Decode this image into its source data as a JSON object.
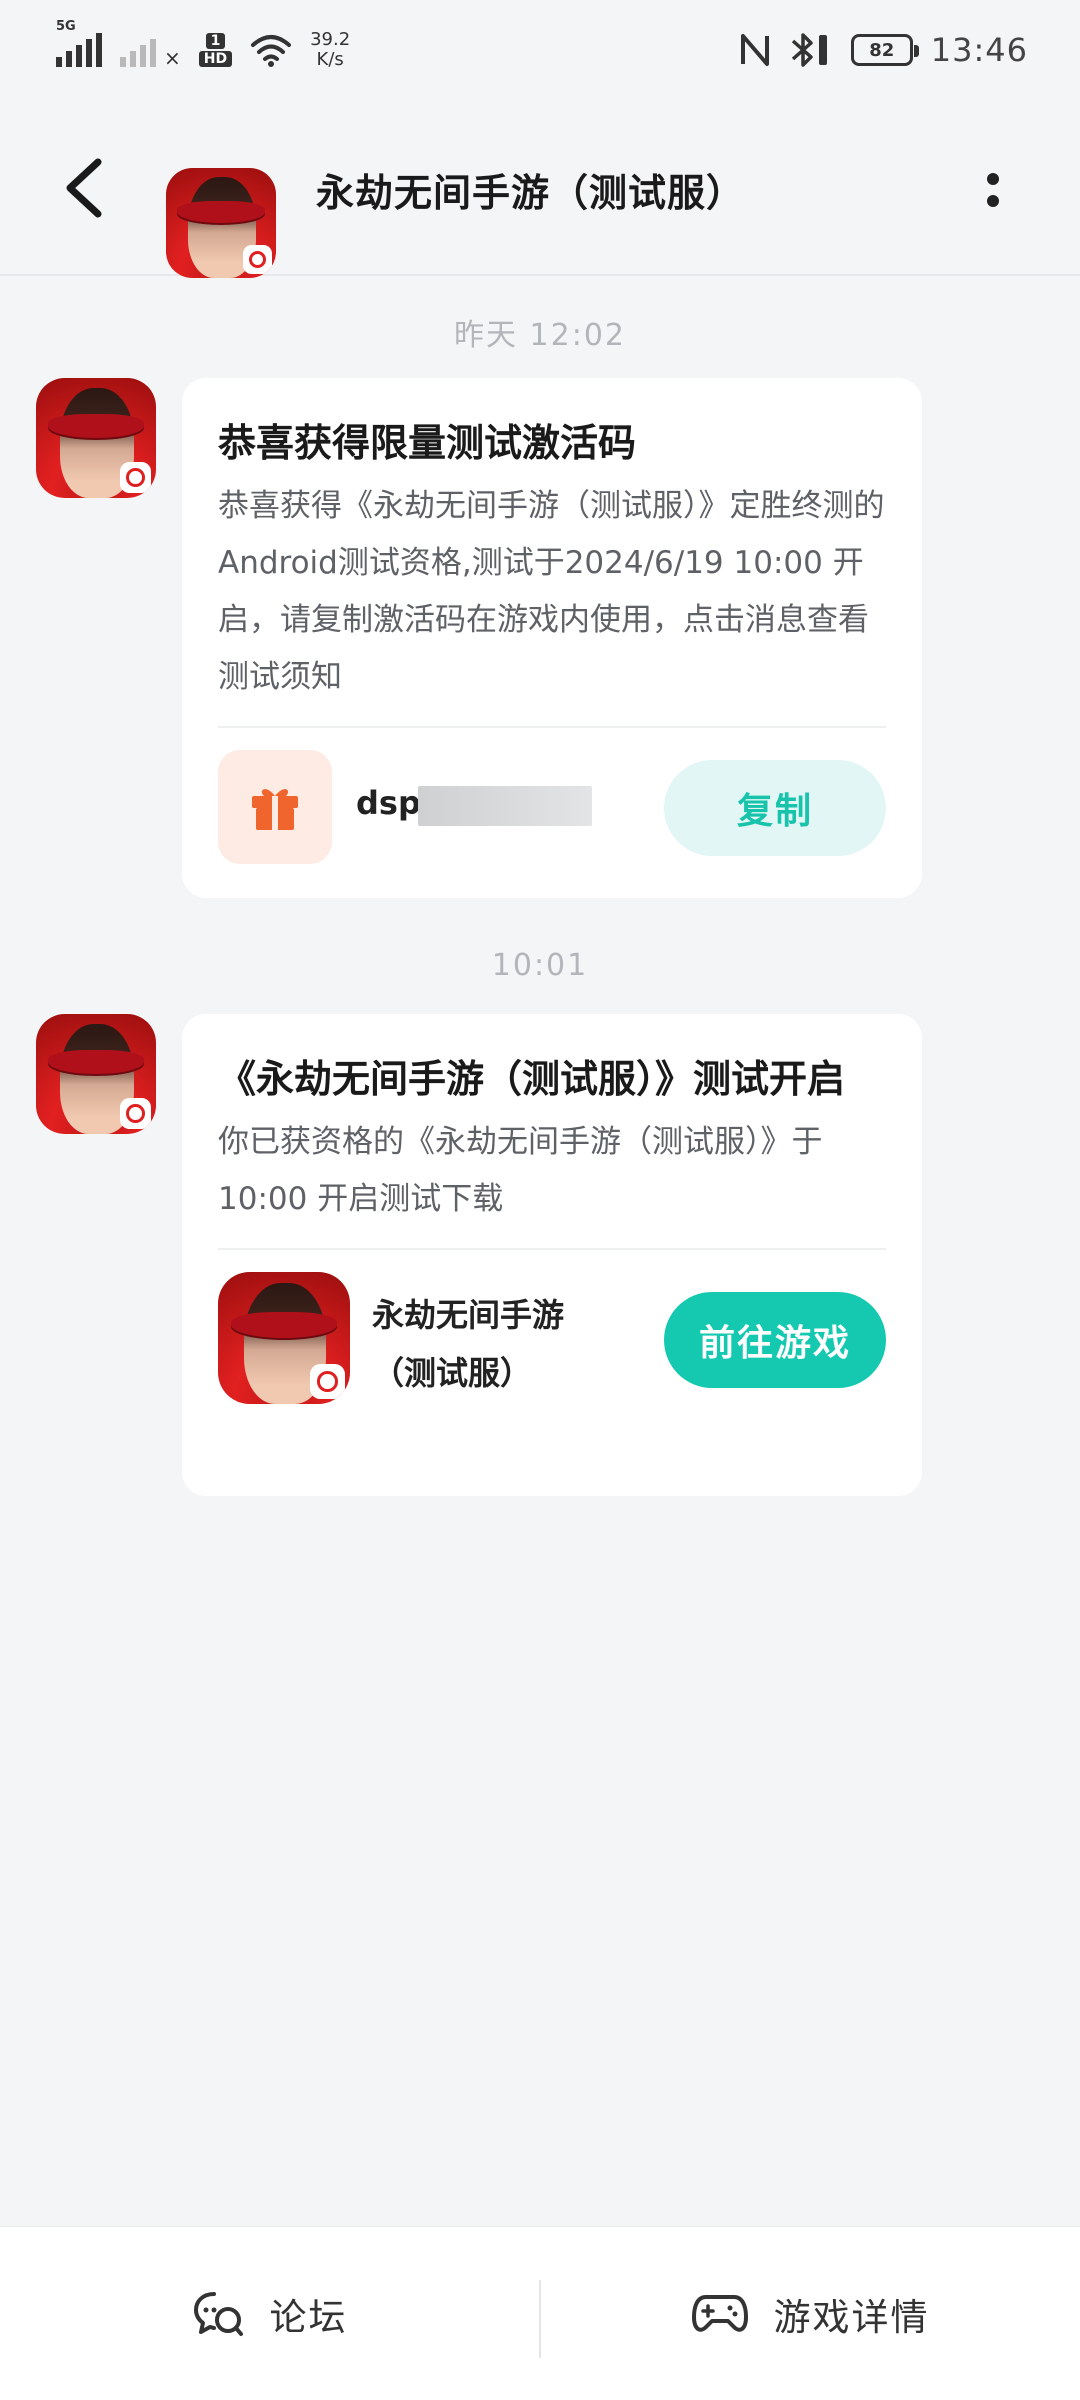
{
  "status_bar": {
    "signal_tag": "5G",
    "hd_top": "1",
    "hd_bottom": "HD",
    "speed_value": "39.2",
    "speed_unit": "K/s",
    "battery": "82",
    "time": "13:46"
  },
  "header": {
    "title": "永劫无间手游（测试服）"
  },
  "messages": [
    {
      "timestamp": "昨天 12:02",
      "title": "恭喜获得限量测试激活码",
      "body": "恭喜获得《永劫无间手游（测试服）》定胜终测的Android测试资格,测试于2024/6/19 10:00 开启，请复制激活码在游戏内使用，点击消息查看测试须知",
      "code_visible": "dsp",
      "button": "复制"
    },
    {
      "timestamp": "10:01",
      "title": "《永劫无间手游（测试服）》测试开启",
      "body": "你已获资格的《永劫无间手游（测试服）》于 10:00 开启测试下载",
      "game_name": "永劫无间手游（测试服）",
      "button": "前往游戏"
    }
  ],
  "bottom_bar": {
    "forum": "论坛",
    "game_detail": "游戏详情"
  },
  "colors": {
    "accent": "#15c9b1",
    "accent_light": "#e2f7f5",
    "background": "#f4f5f7"
  }
}
